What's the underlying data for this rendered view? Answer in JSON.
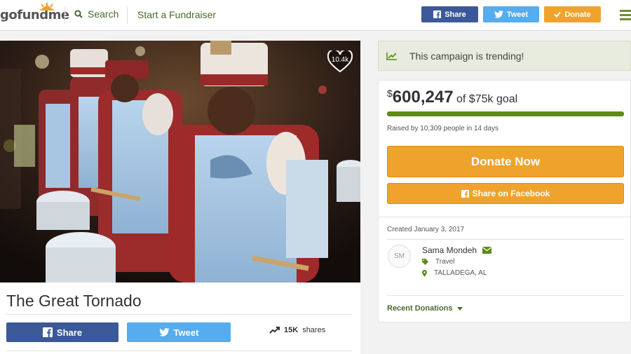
{
  "header": {
    "logo_text": "gofundme",
    "search_label": "Search",
    "start_label": "Start a Fundraiser",
    "share_label": "Share",
    "tweet_label": "Tweet",
    "donate_label": "Donate",
    "colors": {
      "facebook": "#3b5998",
      "twitter": "#55acee",
      "donate": "#f0a32c",
      "brand_green": "#5e8a1a"
    }
  },
  "campaign": {
    "title": "The Great Tornado",
    "hearts": "10.4k",
    "share_label": "Share",
    "tweet_label": "Tweet",
    "shares_count": "15K",
    "shares_suffix": "shares"
  },
  "trending": {
    "text": "This campaign is trending!"
  },
  "progress": {
    "currency": "$",
    "amount": "600,247",
    "goal_text": "of $75k goal",
    "fraction": 1.0,
    "raised_text": "Raised by 10,309 people in 14 days",
    "donate_now": "Donate Now",
    "share_facebook": "Share on Facebook"
  },
  "organizer": {
    "created": "Created January 3, 2017",
    "initials": "SM",
    "name": "Sama Mondeh",
    "category": "Travel",
    "location": "TALLADEGA, AL",
    "recent_donations": "Recent Donations"
  }
}
